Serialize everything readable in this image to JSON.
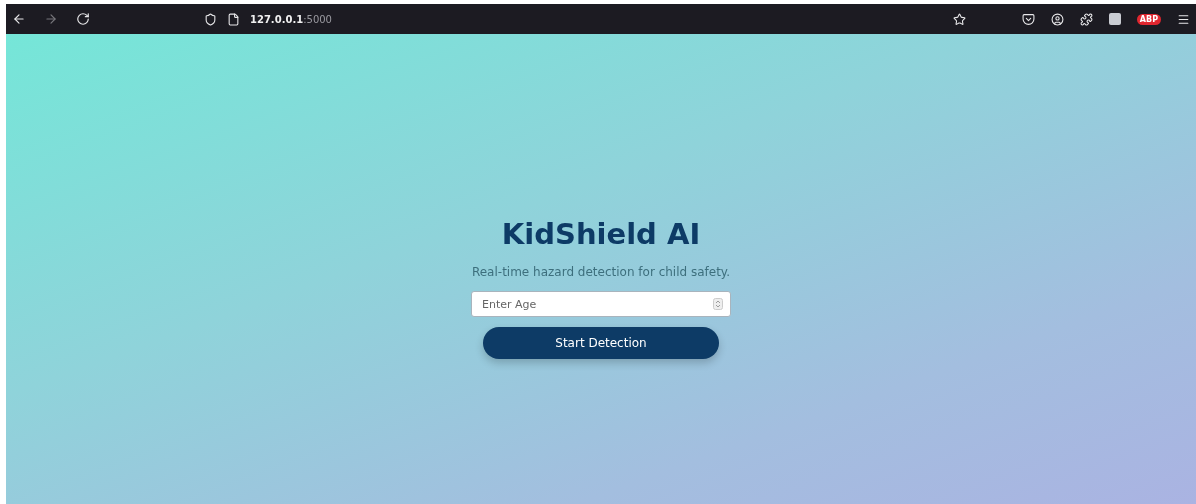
{
  "browser": {
    "url_host": "127.0.0.1",
    "url_port": ":5000",
    "extension_badge": "ABP"
  },
  "page": {
    "title": "KidShield AI",
    "subtitle": "Real-time hazard detection for child safety.",
    "age_field": {
      "placeholder": "Enter Age"
    },
    "start_button": "Start Detection"
  }
}
